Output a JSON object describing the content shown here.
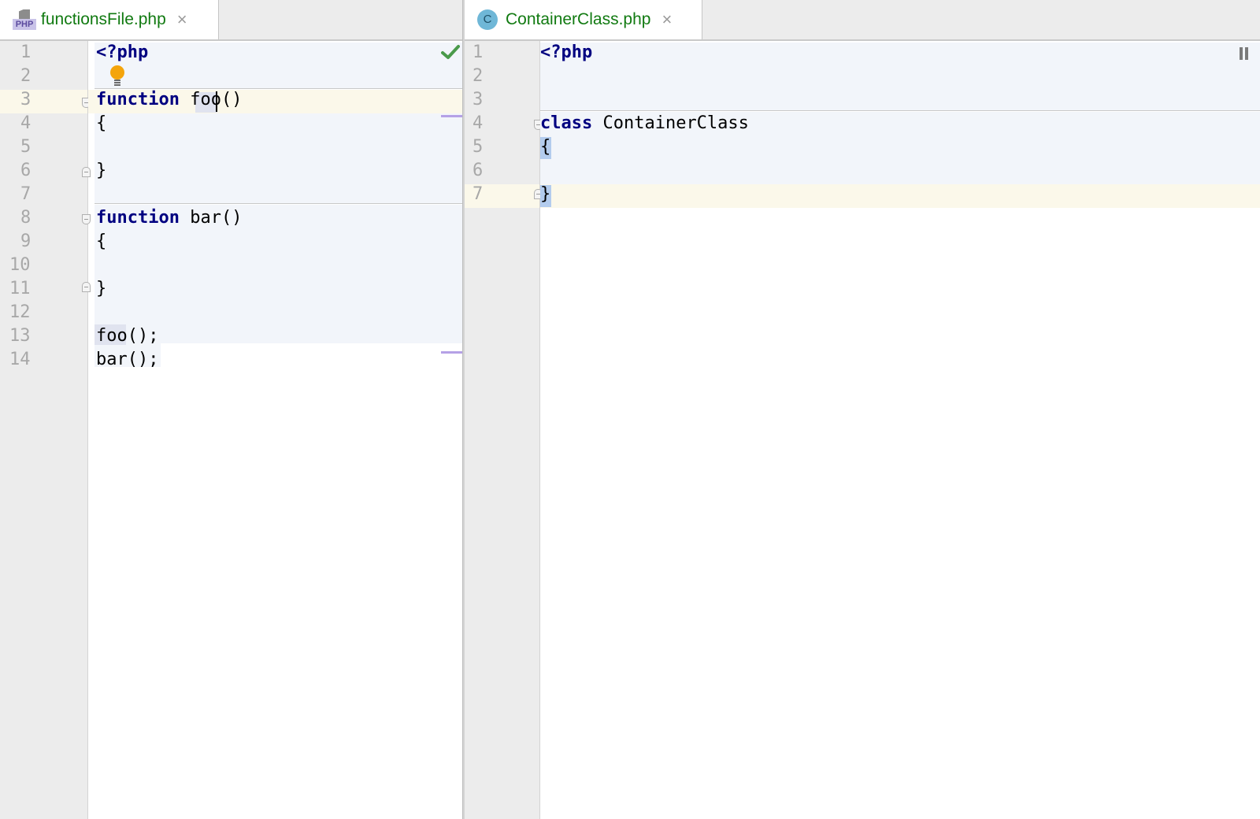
{
  "left_editor": {
    "tab": {
      "label": "functionsFile.php",
      "icon": "php-file-icon",
      "close": "×"
    },
    "status": "check-icon",
    "lines": [
      "1",
      "2",
      "3",
      "4",
      "5",
      "6",
      "7",
      "8",
      "9",
      "10",
      "11",
      "12",
      "13",
      "14"
    ],
    "code": {
      "l1": "<?php",
      "l3_kw": "function",
      "l3_rest": " foo()",
      "l4": "{",
      "l6": "}",
      "l8_kw": "function",
      "l8_rest": " bar()",
      "l9": "{",
      "l11": "}",
      "l13": "foo();",
      "l14": "bar();"
    }
  },
  "right_editor": {
    "tab": {
      "label": "ContainerClass.php",
      "icon_letter": "C",
      "close": "×"
    },
    "lines": [
      "1",
      "2",
      "3",
      "4",
      "5",
      "6",
      "7"
    ],
    "code": {
      "l1": "<?php",
      "l4_kw": "class",
      "l4_rest": " ContainerClass",
      "l5": "{",
      "l7": "}"
    }
  },
  "colors": {
    "tab_text": "#117a11",
    "keyword": "#000080",
    "caret_row": "#fbf8ea",
    "block_bg": "#f2f5fa",
    "brace_match": "#b3ccee"
  }
}
